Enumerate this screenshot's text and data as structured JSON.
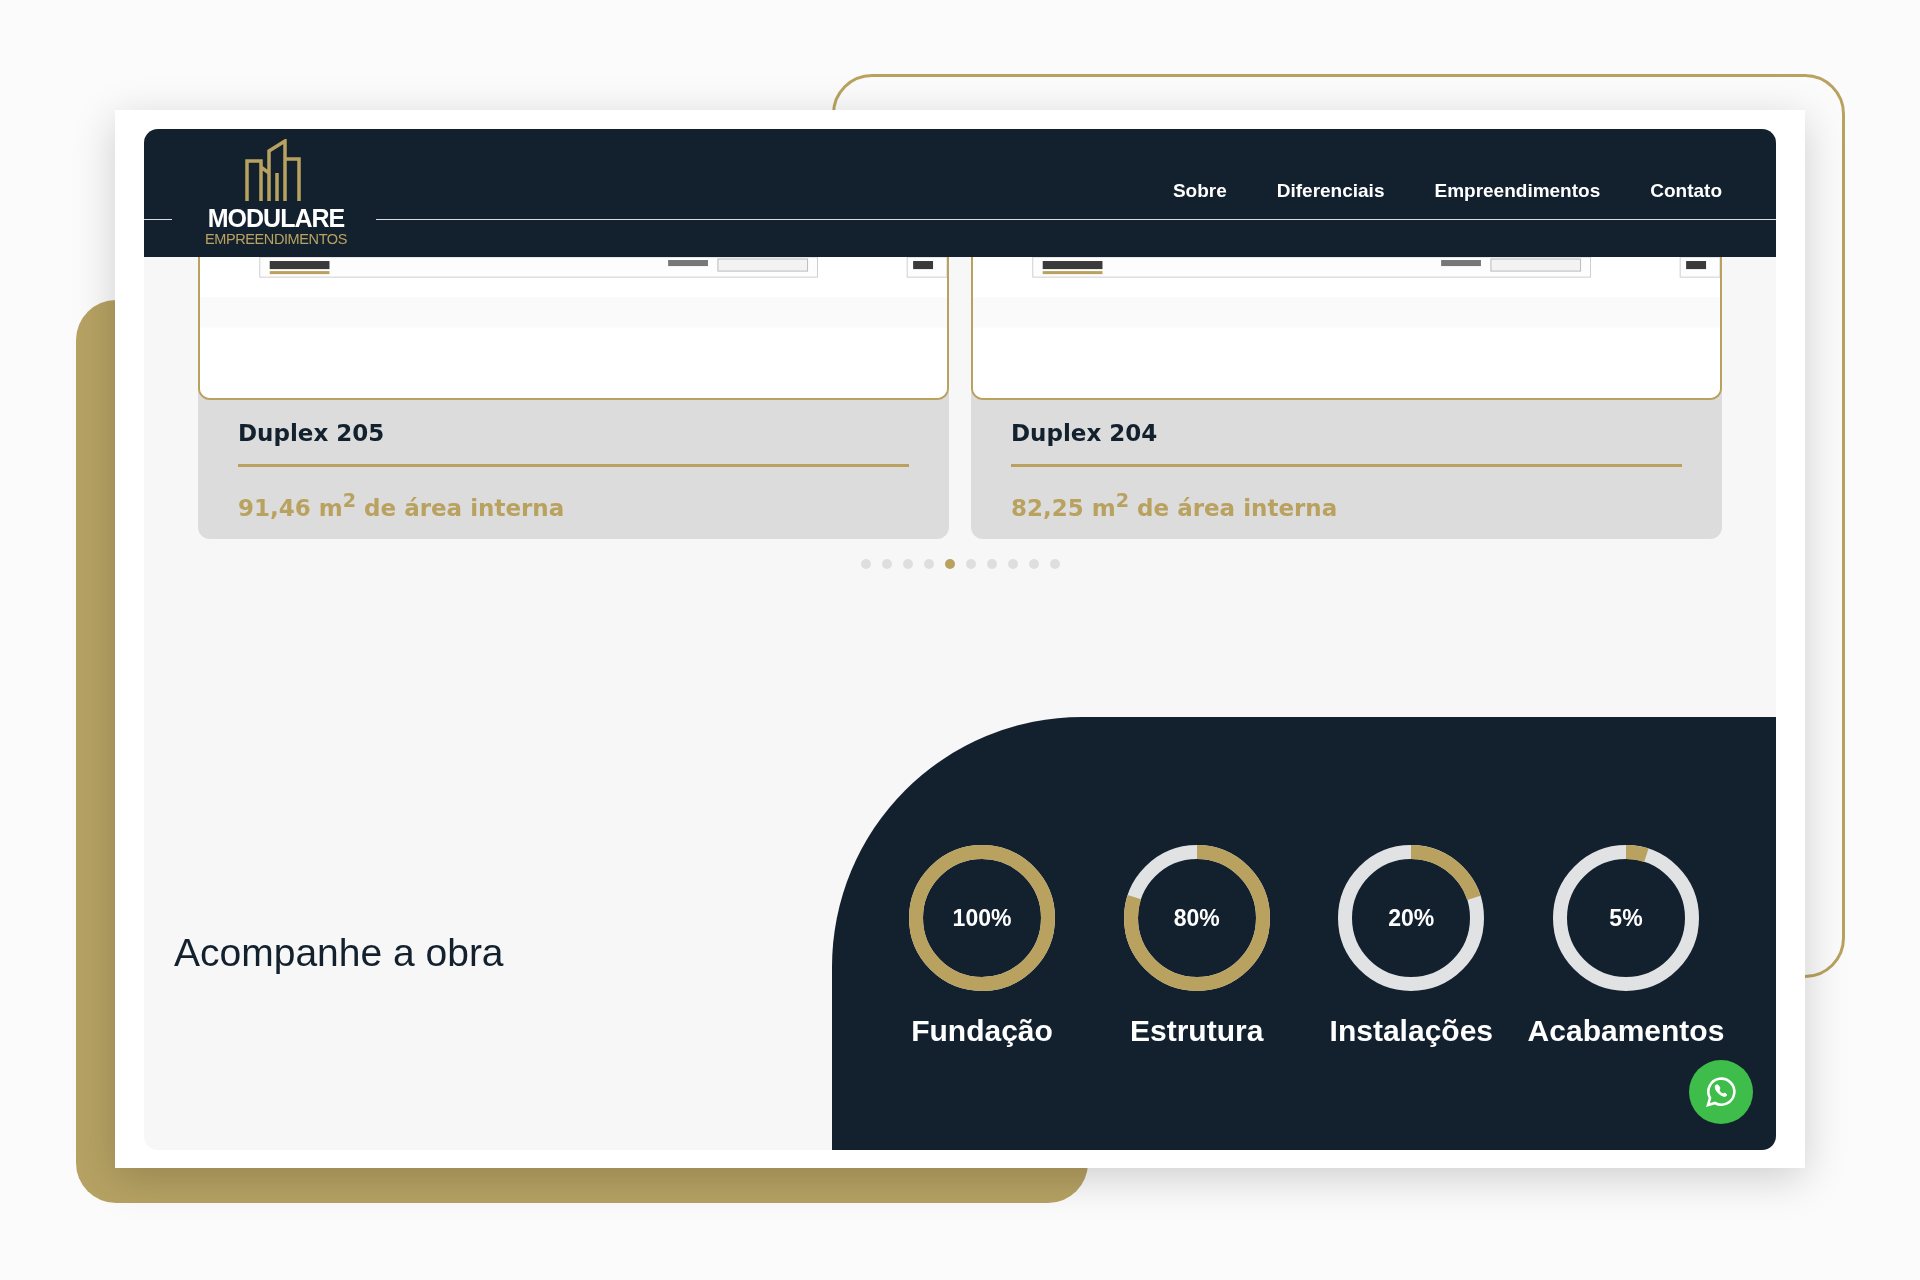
{
  "header": {
    "logo": {
      "name": "MODULARE",
      "tagline": "EMPREENDIMENTOS"
    },
    "nav": [
      {
        "label": "Sobre"
      },
      {
        "label": "Diferenciais"
      },
      {
        "label": "Empreendimentos"
      },
      {
        "label": "Contato"
      }
    ]
  },
  "carousel": {
    "cards": [
      {
        "title": "Duplex 205",
        "area": "91,46 m$^{2}$ de área interna"
      },
      {
        "title": "Duplex 204",
        "area": "82,25 m$^{2}$ de área interna"
      }
    ],
    "dots": [
      {
        "selected": false
      },
      {
        "selected": false
      },
      {
        "selected": false
      },
      {
        "selected": false
      },
      {
        "selected": true
      },
      {
        "selected": false
      },
      {
        "selected": false
      },
      {
        "selected": false
      },
      {
        "selected": false
      },
      {
        "selected": false
      }
    ]
  },
  "progress": {
    "title": "Acompanhe a obra",
    "stages": [
      {
        "label": "Fundação",
        "reading": "100%",
        "level": 1
      },
      {
        "label": "Estrutura",
        "reading": "80%",
        "level": 0.8
      },
      {
        "label": "Instalações",
        "reading": "20%",
        "level": 0.2
      },
      {
        "label": "Acabamentos",
        "reading": "5%",
        "level": 0.05
      }
    ]
  }
}
